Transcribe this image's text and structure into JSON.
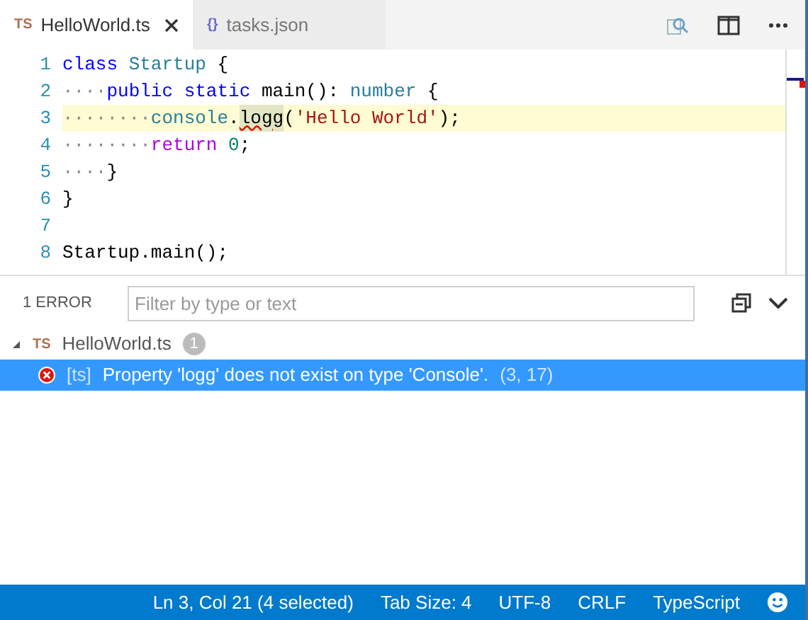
{
  "tabs": [
    {
      "icon": "TS",
      "label": "HelloWorld.ts",
      "selected": true,
      "closable": true
    },
    {
      "icon": "{}",
      "label": "tasks.json",
      "selected": false,
      "closable": false
    }
  ],
  "editor": {
    "lines": [
      {
        "number": "1",
        "highlighted": false,
        "tokens": [
          {
            "kind": "keyword",
            "text": "class"
          },
          {
            "kind": "type",
            "text": " Startup"
          },
          {
            "kind": "plain",
            "text": " {"
          }
        ]
      },
      {
        "number": "2",
        "highlighted": false,
        "tokens": [
          {
            "kind": "ws",
            "text": "····"
          },
          {
            "kind": "keyword",
            "text": "public"
          },
          {
            "kind": "keyword",
            "text": " static"
          },
          {
            "kind": "plain",
            "text": " main(): "
          },
          {
            "kind": "type",
            "text": "number"
          },
          {
            "kind": "plain",
            "text": " {"
          }
        ]
      },
      {
        "number": "3",
        "highlighted": true,
        "tokens": [
          {
            "kind": "ws",
            "text": "········"
          },
          {
            "kind": "type",
            "text": "console"
          },
          {
            "kind": "plain",
            "text": "."
          },
          {
            "kind": "error",
            "text": "logg"
          },
          {
            "kind": "plain",
            "text": "("
          },
          {
            "kind": "string",
            "text": "'Hello World'"
          },
          {
            "kind": "plain",
            "text": ");"
          }
        ]
      },
      {
        "number": "4",
        "highlighted": false,
        "tokens": [
          {
            "kind": "ws",
            "text": "········"
          },
          {
            "kind": "control",
            "text": "return"
          },
          {
            "kind": "number",
            "text": " 0"
          },
          {
            "kind": "plain",
            "text": ";"
          }
        ]
      },
      {
        "number": "5",
        "highlighted": false,
        "tokens": [
          {
            "kind": "ws",
            "text": "····"
          },
          {
            "kind": "plain",
            "text": "}"
          }
        ]
      },
      {
        "number": "6",
        "highlighted": false,
        "tokens": [
          {
            "kind": "plain",
            "text": "}"
          }
        ]
      },
      {
        "number": "7",
        "highlighted": false
      },
      {
        "number": "8",
        "highlighted": false,
        "tokens": [
          {
            "kind": "plain",
            "text": "Startup.main();"
          }
        ]
      }
    ]
  },
  "problems": {
    "count_label": "1 ERROR",
    "filter_placeholder": "Filter by type or text",
    "files": [
      {
        "icon": "TS",
        "name": "HelloWorld.ts",
        "badge": "1",
        "expanded": true,
        "items": [
          {
            "source": "[ts]",
            "message": "Property 'logg' does not exist on type 'Console'.",
            "position": "(3, 17)",
            "selected": true
          }
        ]
      }
    ]
  },
  "status_bar": [
    "Ln 3, Col 21 (4 selected)",
    "Tab Size: 4",
    "UTF-8",
    "CRLF",
    "TypeScript"
  ]
}
